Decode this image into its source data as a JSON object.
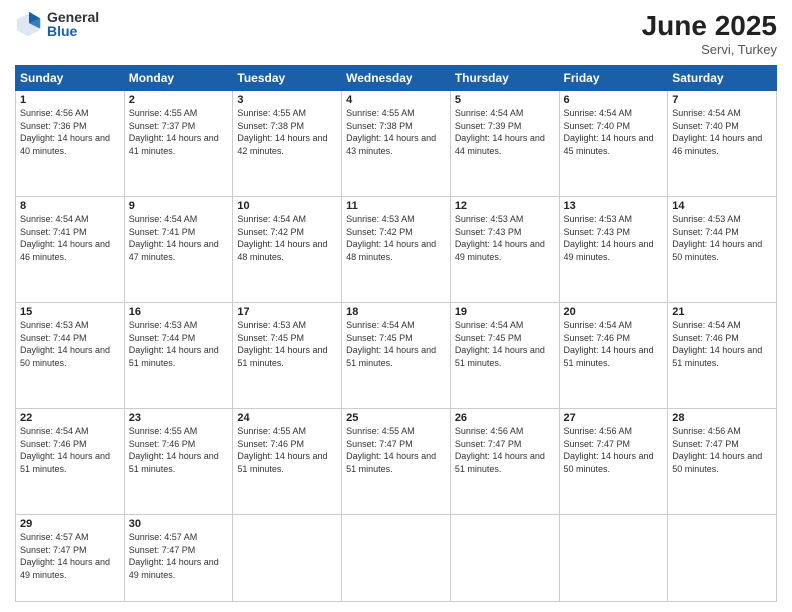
{
  "header": {
    "logo_general": "General",
    "logo_blue": "Blue",
    "month_title": "June 2025",
    "location": "Servi, Turkey"
  },
  "days_of_week": [
    "Sunday",
    "Monday",
    "Tuesday",
    "Wednesday",
    "Thursday",
    "Friday",
    "Saturday"
  ],
  "weeks": [
    [
      {
        "day": 1,
        "sunrise": "Sunrise: 4:56 AM",
        "sunset": "Sunset: 7:36 PM",
        "daylight": "Daylight: 14 hours and 40 minutes."
      },
      {
        "day": 2,
        "sunrise": "Sunrise: 4:55 AM",
        "sunset": "Sunset: 7:37 PM",
        "daylight": "Daylight: 14 hours and 41 minutes."
      },
      {
        "day": 3,
        "sunrise": "Sunrise: 4:55 AM",
        "sunset": "Sunset: 7:38 PM",
        "daylight": "Daylight: 14 hours and 42 minutes."
      },
      {
        "day": 4,
        "sunrise": "Sunrise: 4:55 AM",
        "sunset": "Sunset: 7:38 PM",
        "daylight": "Daylight: 14 hours and 43 minutes."
      },
      {
        "day": 5,
        "sunrise": "Sunrise: 4:54 AM",
        "sunset": "Sunset: 7:39 PM",
        "daylight": "Daylight: 14 hours and 44 minutes."
      },
      {
        "day": 6,
        "sunrise": "Sunrise: 4:54 AM",
        "sunset": "Sunset: 7:40 PM",
        "daylight": "Daylight: 14 hours and 45 minutes."
      },
      {
        "day": 7,
        "sunrise": "Sunrise: 4:54 AM",
        "sunset": "Sunset: 7:40 PM",
        "daylight": "Daylight: 14 hours and 46 minutes."
      }
    ],
    [
      {
        "day": 8,
        "sunrise": "Sunrise: 4:54 AM",
        "sunset": "Sunset: 7:41 PM",
        "daylight": "Daylight: 14 hours and 46 minutes."
      },
      {
        "day": 9,
        "sunrise": "Sunrise: 4:54 AM",
        "sunset": "Sunset: 7:41 PM",
        "daylight": "Daylight: 14 hours and 47 minutes."
      },
      {
        "day": 10,
        "sunrise": "Sunrise: 4:54 AM",
        "sunset": "Sunset: 7:42 PM",
        "daylight": "Daylight: 14 hours and 48 minutes."
      },
      {
        "day": 11,
        "sunrise": "Sunrise: 4:53 AM",
        "sunset": "Sunset: 7:42 PM",
        "daylight": "Daylight: 14 hours and 48 minutes."
      },
      {
        "day": 12,
        "sunrise": "Sunrise: 4:53 AM",
        "sunset": "Sunset: 7:43 PM",
        "daylight": "Daylight: 14 hours and 49 minutes."
      },
      {
        "day": 13,
        "sunrise": "Sunrise: 4:53 AM",
        "sunset": "Sunset: 7:43 PM",
        "daylight": "Daylight: 14 hours and 49 minutes."
      },
      {
        "day": 14,
        "sunrise": "Sunrise: 4:53 AM",
        "sunset": "Sunset: 7:44 PM",
        "daylight": "Daylight: 14 hours and 50 minutes."
      }
    ],
    [
      {
        "day": 15,
        "sunrise": "Sunrise: 4:53 AM",
        "sunset": "Sunset: 7:44 PM",
        "daylight": "Daylight: 14 hours and 50 minutes."
      },
      {
        "day": 16,
        "sunrise": "Sunrise: 4:53 AM",
        "sunset": "Sunset: 7:44 PM",
        "daylight": "Daylight: 14 hours and 51 minutes."
      },
      {
        "day": 17,
        "sunrise": "Sunrise: 4:53 AM",
        "sunset": "Sunset: 7:45 PM",
        "daylight": "Daylight: 14 hours and 51 minutes."
      },
      {
        "day": 18,
        "sunrise": "Sunrise: 4:54 AM",
        "sunset": "Sunset: 7:45 PM",
        "daylight": "Daylight: 14 hours and 51 minutes."
      },
      {
        "day": 19,
        "sunrise": "Sunrise: 4:54 AM",
        "sunset": "Sunset: 7:45 PM",
        "daylight": "Daylight: 14 hours and 51 minutes."
      },
      {
        "day": 20,
        "sunrise": "Sunrise: 4:54 AM",
        "sunset": "Sunset: 7:46 PM",
        "daylight": "Daylight: 14 hours and 51 minutes."
      },
      {
        "day": 21,
        "sunrise": "Sunrise: 4:54 AM",
        "sunset": "Sunset: 7:46 PM",
        "daylight": "Daylight: 14 hours and 51 minutes."
      }
    ],
    [
      {
        "day": 22,
        "sunrise": "Sunrise: 4:54 AM",
        "sunset": "Sunset: 7:46 PM",
        "daylight": "Daylight: 14 hours and 51 minutes."
      },
      {
        "day": 23,
        "sunrise": "Sunrise: 4:55 AM",
        "sunset": "Sunset: 7:46 PM",
        "daylight": "Daylight: 14 hours and 51 minutes."
      },
      {
        "day": 24,
        "sunrise": "Sunrise: 4:55 AM",
        "sunset": "Sunset: 7:46 PM",
        "daylight": "Daylight: 14 hours and 51 minutes."
      },
      {
        "day": 25,
        "sunrise": "Sunrise: 4:55 AM",
        "sunset": "Sunset: 7:47 PM",
        "daylight": "Daylight: 14 hours and 51 minutes."
      },
      {
        "day": 26,
        "sunrise": "Sunrise: 4:56 AM",
        "sunset": "Sunset: 7:47 PM",
        "daylight": "Daylight: 14 hours and 51 minutes."
      },
      {
        "day": 27,
        "sunrise": "Sunrise: 4:56 AM",
        "sunset": "Sunset: 7:47 PM",
        "daylight": "Daylight: 14 hours and 50 minutes."
      },
      {
        "day": 28,
        "sunrise": "Sunrise: 4:56 AM",
        "sunset": "Sunset: 7:47 PM",
        "daylight": "Daylight: 14 hours and 50 minutes."
      }
    ],
    [
      {
        "day": 29,
        "sunrise": "Sunrise: 4:57 AM",
        "sunset": "Sunset: 7:47 PM",
        "daylight": "Daylight: 14 hours and 49 minutes."
      },
      {
        "day": 30,
        "sunrise": "Sunrise: 4:57 AM",
        "sunset": "Sunset: 7:47 PM",
        "daylight": "Daylight: 14 hours and 49 minutes."
      },
      null,
      null,
      null,
      null,
      null
    ]
  ]
}
